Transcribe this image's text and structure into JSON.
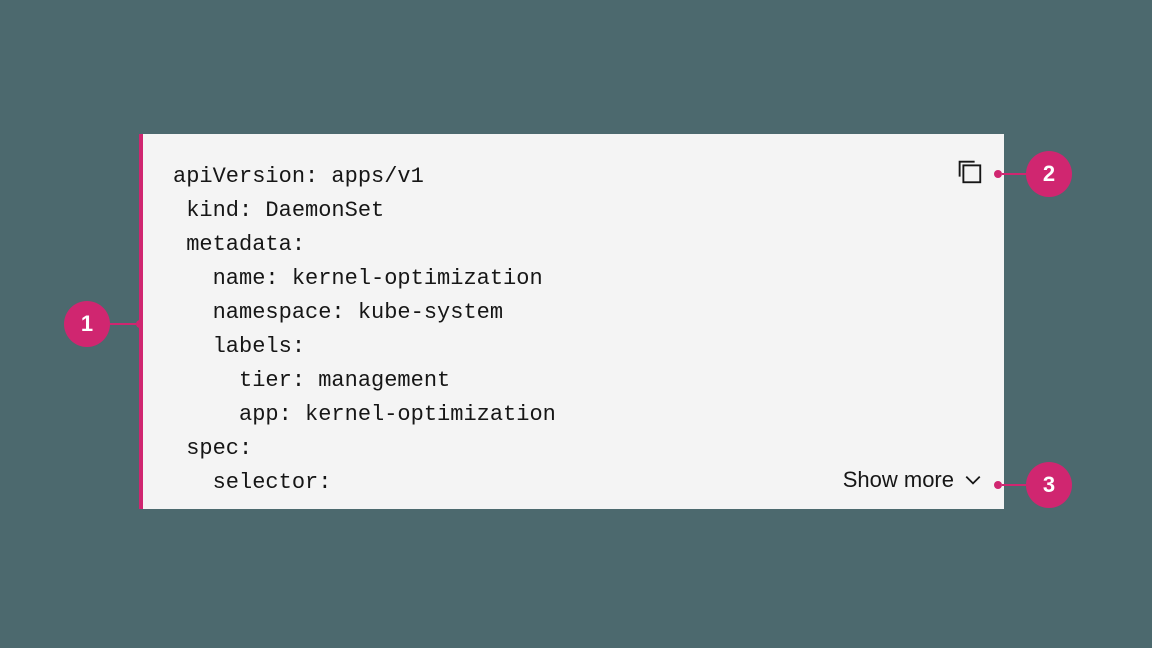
{
  "code": {
    "text": "apiVersion: apps/v1\n kind: DaemonSet\n metadata:\n   name: kernel-optimization\n   namespace: kube-system\n   labels:\n     tier: management\n     app: kernel-optimization\n spec:\n   selector:"
  },
  "show_more_label": "Show more",
  "callouts": {
    "left": "1",
    "copy": "2",
    "showmore": "3"
  },
  "accent_color": "#d02670"
}
